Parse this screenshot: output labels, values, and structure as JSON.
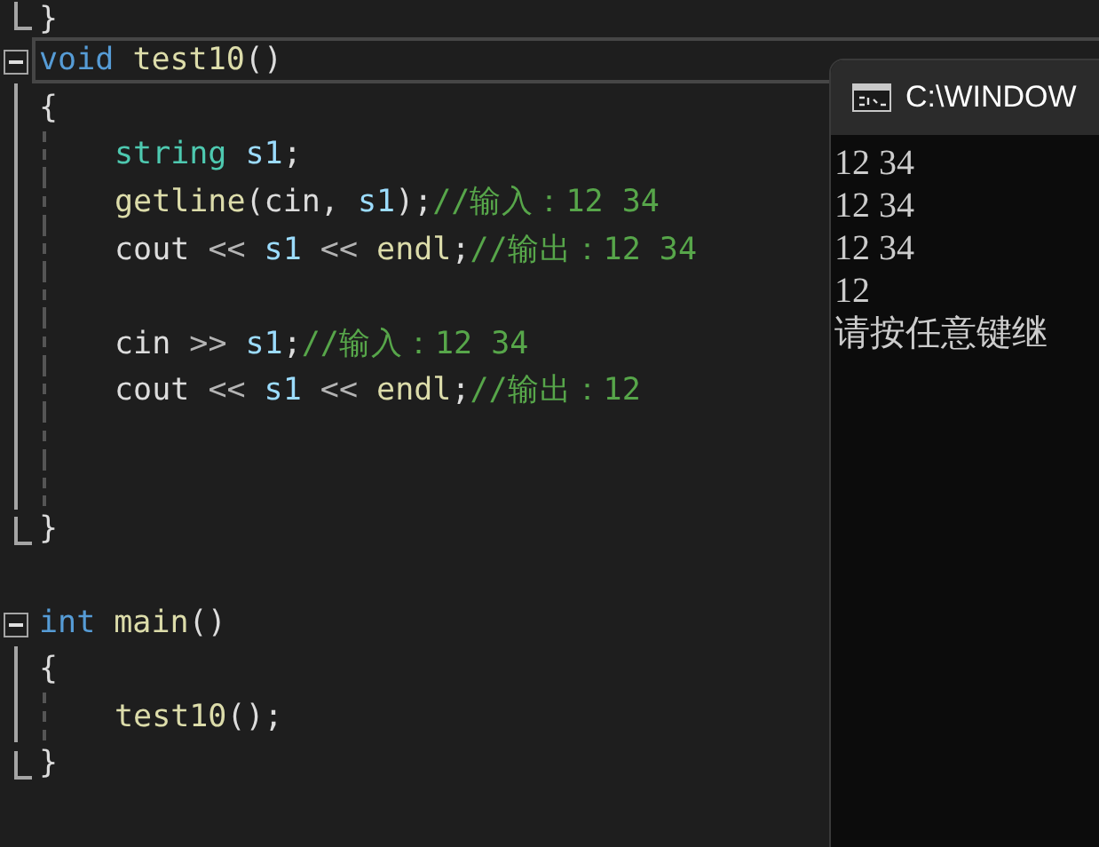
{
  "editor": {
    "lines": [
      {
        "kind": "end",
        "current": false,
        "tokens": [
          {
            "kind": "plain",
            "text": "}"
          }
        ]
      },
      {
        "kind": "start",
        "current": true,
        "tokens": [
          {
            "kind": "keyword",
            "text": "void"
          },
          {
            "kind": "function",
            "text": " test10"
          },
          {
            "kind": "plain",
            "text": "()"
          }
        ]
      },
      {
        "kind": "body",
        "current": false,
        "tokens": [
          {
            "kind": "plain",
            "text": "{"
          }
        ]
      },
      {
        "kind": "inner",
        "current": false,
        "tokens": [
          {
            "kind": "type",
            "text": "string"
          },
          {
            "kind": "variable",
            "text": " s1"
          },
          {
            "kind": "plain",
            "text": ";"
          }
        ]
      },
      {
        "kind": "inner",
        "current": false,
        "tokens": [
          {
            "kind": "function",
            "text": "getline"
          },
          {
            "kind": "plain",
            "text": "(cin, "
          },
          {
            "kind": "variable",
            "text": "s1"
          },
          {
            "kind": "plain",
            "text": ");"
          },
          {
            "kind": "comment",
            "text": "//输入：12 34"
          }
        ]
      },
      {
        "kind": "inner",
        "current": false,
        "tokens": [
          {
            "kind": "plain",
            "text": "cout "
          },
          {
            "kind": "operator",
            "text": "<<"
          },
          {
            "kind": "variable",
            "text": " s1 "
          },
          {
            "kind": "operator",
            "text": "<<"
          },
          {
            "kind": "function",
            "text": " endl"
          },
          {
            "kind": "plain",
            "text": ";"
          },
          {
            "kind": "comment",
            "text": "//输出：12 34"
          }
        ]
      },
      {
        "kind": "inner",
        "current": false
      },
      {
        "kind": "inner",
        "current": false,
        "tokens": [
          {
            "kind": "plain",
            "text": "cin "
          },
          {
            "kind": "operator",
            "text": ">>"
          },
          {
            "kind": "variable",
            "text": " s1"
          },
          {
            "kind": "plain",
            "text": ";"
          },
          {
            "kind": "comment",
            "text": "//输入：12 34"
          }
        ]
      },
      {
        "kind": "inner",
        "current": false,
        "tokens": [
          {
            "kind": "plain",
            "text": "cout "
          },
          {
            "kind": "operator",
            "text": "<<"
          },
          {
            "kind": "variable",
            "text": " s1 "
          },
          {
            "kind": "operator",
            "text": "<<"
          },
          {
            "kind": "function",
            "text": " endl"
          },
          {
            "kind": "plain",
            "text": ";"
          },
          {
            "kind": "comment",
            "text": "//输出：12"
          }
        ]
      },
      {
        "kind": "inner",
        "current": false
      },
      {
        "kind": "inner",
        "current": false
      },
      {
        "kind": "end",
        "current": false,
        "tokens": [
          {
            "kind": "plain",
            "text": "}"
          }
        ]
      },
      {
        "kind": "none",
        "current": false
      },
      {
        "kind": "start",
        "current": false,
        "tokens": [
          {
            "kind": "keyword",
            "text": "int"
          },
          {
            "kind": "function",
            "text": " main"
          },
          {
            "kind": "plain",
            "text": "()"
          }
        ]
      },
      {
        "kind": "body",
        "current": false,
        "tokens": [
          {
            "kind": "plain",
            "text": "{"
          }
        ]
      },
      {
        "kind": "inner",
        "current": false,
        "tokens": [
          {
            "kind": "function",
            "text": "test10"
          },
          {
            "kind": "plain",
            "text": "();"
          }
        ]
      },
      {
        "kind": "end",
        "current": false,
        "tokens": [
          {
            "kind": "plain",
            "text": "}"
          }
        ]
      },
      {
        "kind": "none",
        "current": false
      }
    ]
  },
  "console": {
    "title": "C:\\WINDOW",
    "output": [
      "12 34",
      "12 34",
      "12 34",
      "12",
      "请按任意键继"
    ]
  }
}
